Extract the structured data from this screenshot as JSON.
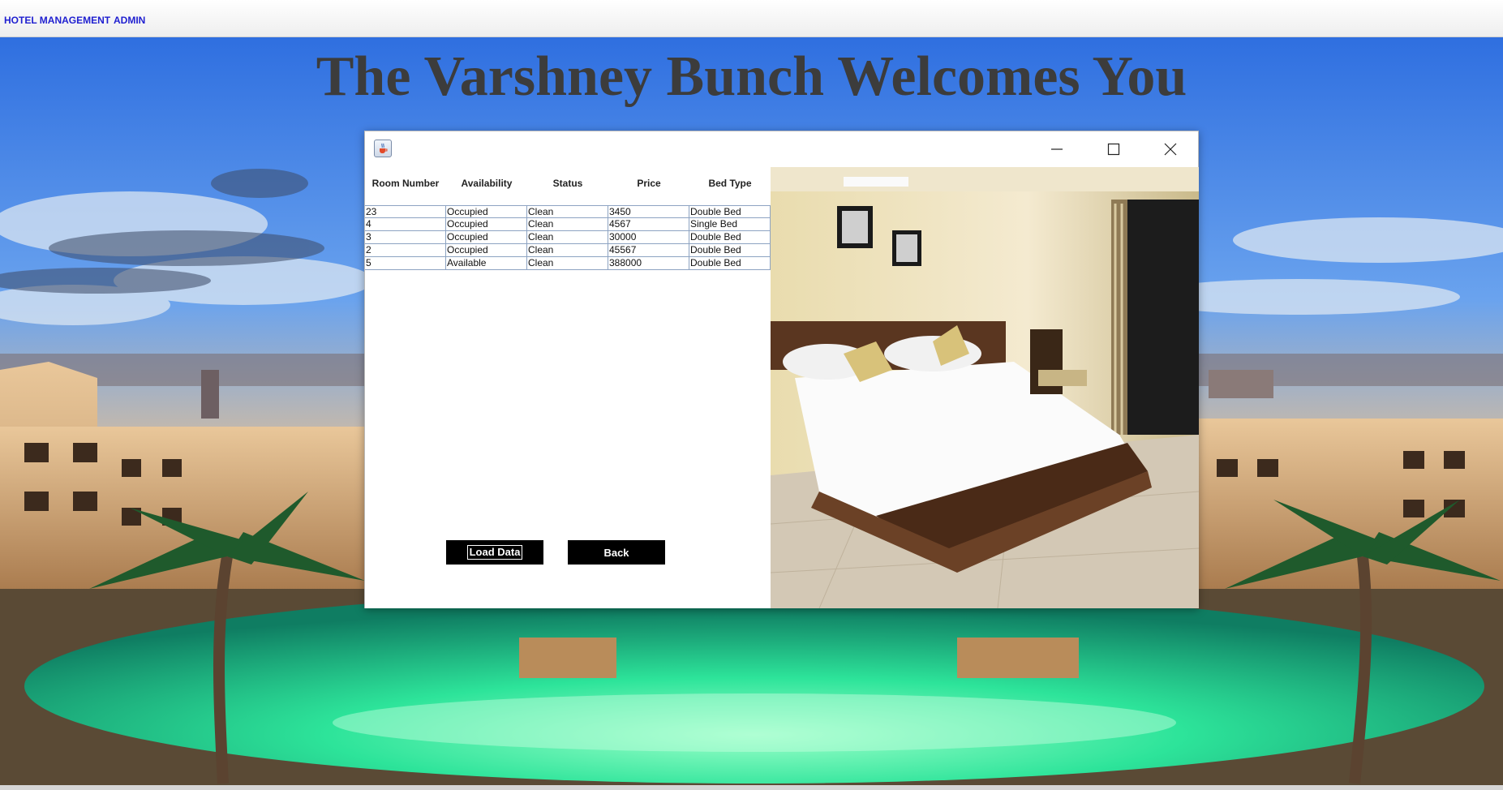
{
  "menubar": {
    "items": [
      {
        "label": "HOTEL MANAGEMENT"
      },
      {
        "label": "ADMIN"
      }
    ]
  },
  "heading": "The Varshney Bunch Welcomes You",
  "dialog": {
    "icon": "java-cup-icon",
    "controls": [
      "minimize-icon",
      "maximize-icon",
      "close-icon"
    ],
    "table": {
      "columns": [
        "Room Number",
        "Availability",
        "Status",
        "Price",
        "Bed Type"
      ],
      "rows": [
        [
          "23",
          "Occupied",
          "Clean",
          "3450",
          "Double Bed"
        ],
        [
          "4",
          "Occupied",
          "Clean",
          "4567",
          "Single Bed"
        ],
        [
          "3",
          "Occupied",
          "Clean",
          "30000",
          "Double Bed"
        ],
        [
          "2",
          "Occupied",
          "Clean",
          "45567",
          "Double Bed"
        ],
        [
          "5",
          "Available",
          "Clean",
          "388000",
          "Double Bed"
        ]
      ]
    },
    "buttons": {
      "load_label": "Load Data",
      "back_label": "Back"
    }
  },
  "colors": {
    "menu_text": "#1f1fd0",
    "heading_text": "#3c3c3c",
    "button_bg": "#000000",
    "table_grid": "#8da3c2"
  }
}
